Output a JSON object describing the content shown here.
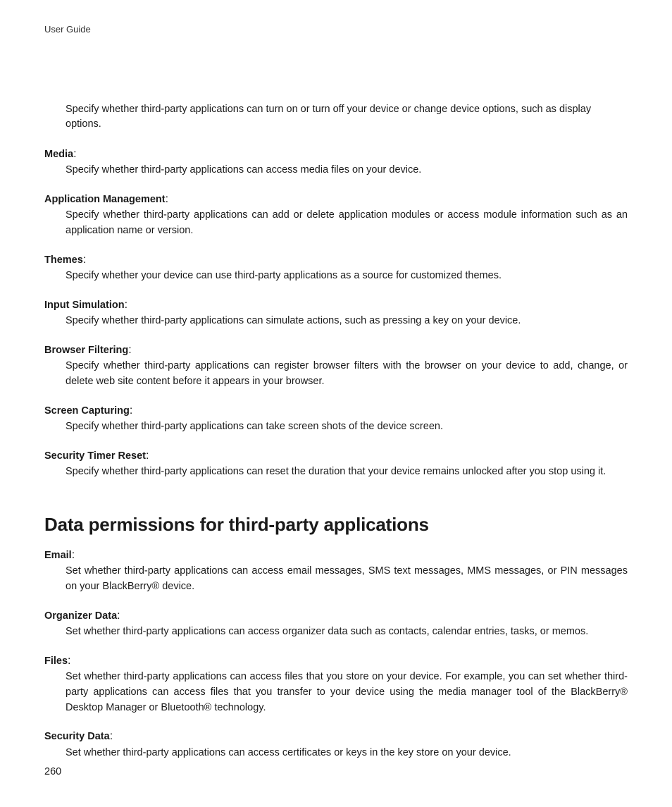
{
  "header": "User Guide",
  "intro": "Specify whether third-party applications can turn on or turn off your device or change device options, such as display options.",
  "interaction_items": [
    {
      "term": "Media",
      "desc": "Specify whether third-party applications can access media files on your device."
    },
    {
      "term": "Application Management",
      "desc": "Specify whether third-party applications can add or delete application modules or access module information such as an application name or version."
    },
    {
      "term": "Themes",
      "desc": "Specify whether your device can use third-party applications as a source for customized themes."
    },
    {
      "term": "Input Simulation",
      "desc": "Specify whether third-party applications can simulate actions, such as pressing a key on your device."
    },
    {
      "term": "Browser Filtering",
      "desc": "Specify whether third-party applications can register browser filters with the browser on your device to add, change, or delete web site content before it appears in your browser."
    },
    {
      "term": "Screen Capturing",
      "desc": "Specify whether third-party applications can take screen shots of the device screen."
    },
    {
      "term": "Security Timer Reset",
      "desc": "Specify whether third-party applications can reset the duration that your device remains unlocked after you stop using it."
    }
  ],
  "section_heading": "Data permissions for third-party applications",
  "data_items": [
    {
      "term": "Email",
      "desc": "Set whether third-party applications can access email messages, SMS text messages, MMS messages, or PIN messages on your BlackBerry® device."
    },
    {
      "term": "Organizer Data",
      "desc": "Set whether third-party applications can access organizer data such as contacts, calendar entries, tasks, or memos."
    },
    {
      "term": "Files",
      "desc": "Set whether third-party applications can access files that you store on your device. For example, you can set whether third-party applications can access files that you transfer to your device using the media manager tool of the BlackBerry® Desktop Manager or Bluetooth® technology."
    },
    {
      "term": "Security Data",
      "desc": "Set whether third-party applications can access certificates or keys in the key store on your device."
    }
  ],
  "page_number": "260"
}
